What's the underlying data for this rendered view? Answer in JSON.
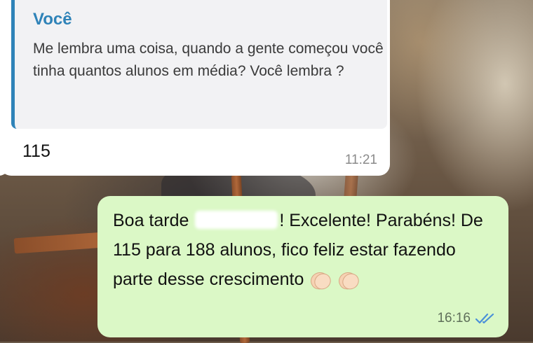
{
  "incoming": {
    "quote": {
      "author": "Você",
      "text": "Me lembra uma coisa, quando a gente começou você tinha quantos alunos em média? Você lembra ?"
    },
    "reply": "115",
    "time": "11:21"
  },
  "outgoing": {
    "text_before_redaction": "Boa tarde ",
    "text_after_redaction": "! Excelente! Parabéns! De 115 para 188 alunos, fico feliz estar fazendo parte desse crescimento",
    "emojis": [
      "clapping-hands",
      "clapping-hands"
    ],
    "time": "16:16",
    "status": "read",
    "tick_color": "#4a90d9"
  },
  "colors": {
    "quote_accent": "#2f83b8",
    "outgoing_bubble": "#dbf8c6",
    "incoming_bubble": "#ffffff"
  }
}
